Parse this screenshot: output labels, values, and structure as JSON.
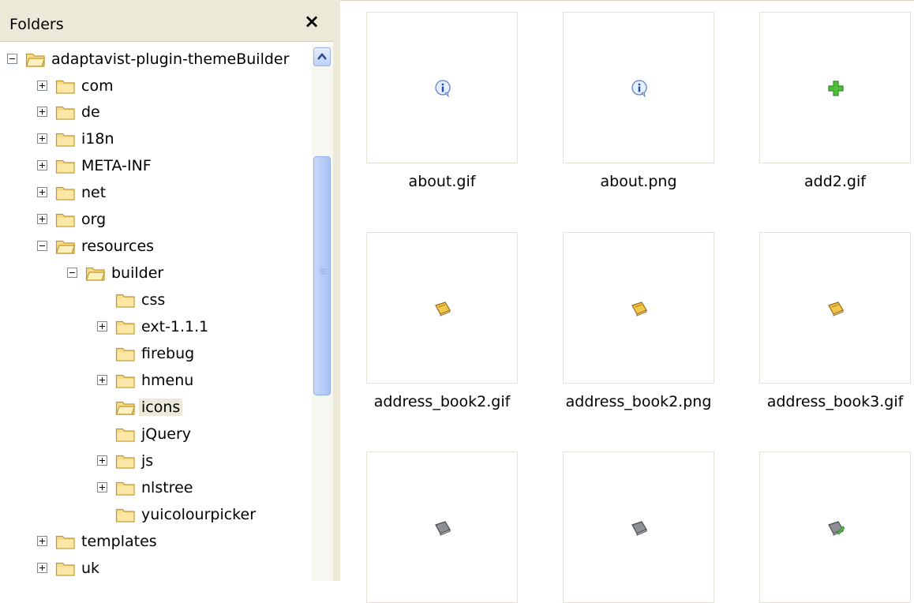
{
  "folders_pane": {
    "title": "Folders",
    "close_symbol": "×"
  },
  "tree": [
    {
      "label": "adaptavist-plugin-themeBuilder",
      "expander": "minus",
      "selected": false
    },
    {
      "label": "com",
      "expander": "plus",
      "selected": false
    },
    {
      "label": "de",
      "expander": "plus",
      "selected": false
    },
    {
      "label": "i18n",
      "expander": "plus",
      "selected": false
    },
    {
      "label": "META-INF",
      "expander": "plus",
      "selected": false
    },
    {
      "label": "net",
      "expander": "plus",
      "selected": false
    },
    {
      "label": "org",
      "expander": "plus",
      "selected": false
    },
    {
      "label": "resources",
      "expander": "minus",
      "selected": false
    },
    {
      "label": "builder",
      "expander": "minus",
      "selected": false
    },
    {
      "label": "css",
      "expander": "none",
      "selected": false
    },
    {
      "label": "ext-1.1.1",
      "expander": "plus",
      "selected": false
    },
    {
      "label": "firebug",
      "expander": "none",
      "selected": false
    },
    {
      "label": "hmenu",
      "expander": "plus",
      "selected": false
    },
    {
      "label": "icons",
      "expander": "none",
      "selected": true
    },
    {
      "label": "jQuery",
      "expander": "none",
      "selected": false
    },
    {
      "label": "js",
      "expander": "plus",
      "selected": false
    },
    {
      "label": "nlstree",
      "expander": "plus",
      "selected": false
    },
    {
      "label": "yuicolourpicker",
      "expander": "none",
      "selected": false
    },
    {
      "label": "templates",
      "expander": "plus",
      "selected": false
    },
    {
      "label": "uk",
      "expander": "plus",
      "selected": false
    }
  ],
  "thumbnails": [
    {
      "name": "about.gif",
      "icon": "info-icon"
    },
    {
      "name": "about.png",
      "icon": "info-icon"
    },
    {
      "name": "add2.gif",
      "icon": "green-plus-icon"
    },
    {
      "name": "address_book2.gif",
      "icon": "address-book-icon"
    },
    {
      "name": "address_book2.png",
      "icon": "address-book-icon"
    },
    {
      "name": "address_book3.gif",
      "icon": "address-book-icon"
    },
    {
      "name": "",
      "icon": "grey-book-icon"
    },
    {
      "name": "",
      "icon": "grey-book-icon"
    },
    {
      "name": "",
      "icon": "grey-book-edit-icon"
    }
  ],
  "colors": {
    "chrome": "#ece9d8",
    "folder_fill": "#f7dc8a",
    "folder_stroke": "#c2962a",
    "scroll_thumb": "#b6cbf8"
  }
}
